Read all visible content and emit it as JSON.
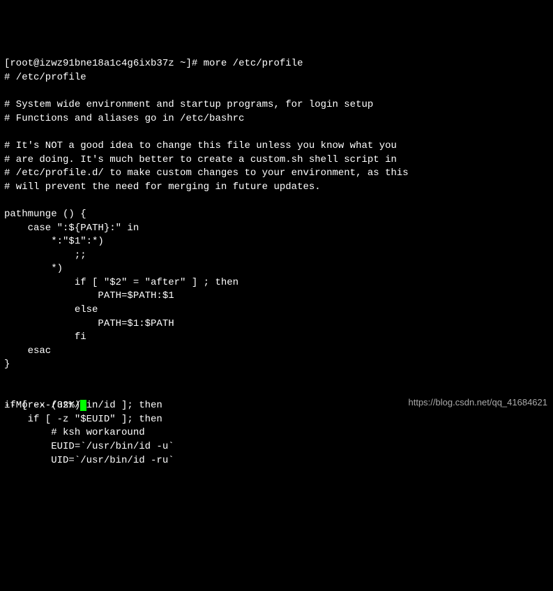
{
  "prompt": {
    "user_host": "[root@izwz91bne18a1c4g6ixb37z ~]# ",
    "command": "more /etc/profile"
  },
  "file_content": {
    "line1": "# /etc/profile",
    "blank1": "",
    "line2": "# System wide environment and startup programs, for login setup",
    "line3": "# Functions and aliases go in /etc/bashrc",
    "blank2": "",
    "line4": "# It's NOT a good idea to change this file unless you know what you",
    "line5": "# are doing. It's much better to create a custom.sh shell script in",
    "line6": "# /etc/profile.d/ to make custom changes to your environment, as this",
    "line7": "# will prevent the need for merging in future updates.",
    "blank3": "",
    "line8": "pathmunge () {",
    "line9": "    case \":${PATH}:\" in",
    "line10": "        *:\"$1\":*)",
    "line11": "            ;;",
    "line12": "        *)",
    "line13": "            if [ \"$2\" = \"after\" ] ; then",
    "line14": "                PATH=$PATH:$1",
    "line15": "            else",
    "line16": "                PATH=$1:$PATH",
    "line17": "            fi",
    "line18": "    esac",
    "line19": "}",
    "blank4": "",
    "blank5": "",
    "line20": "if [ -x /usr/bin/id ]; then",
    "line21": "    if [ -z \"$EUID\" ]; then",
    "line22": "        # ksh workaround",
    "line23": "        EUID=`/usr/bin/id -u`",
    "line24": "        UID=`/usr/bin/id -ru`"
  },
  "pager": {
    "more_text": "--More--(32%)"
  },
  "watermark": "https://blog.csdn.net/qq_41684621"
}
